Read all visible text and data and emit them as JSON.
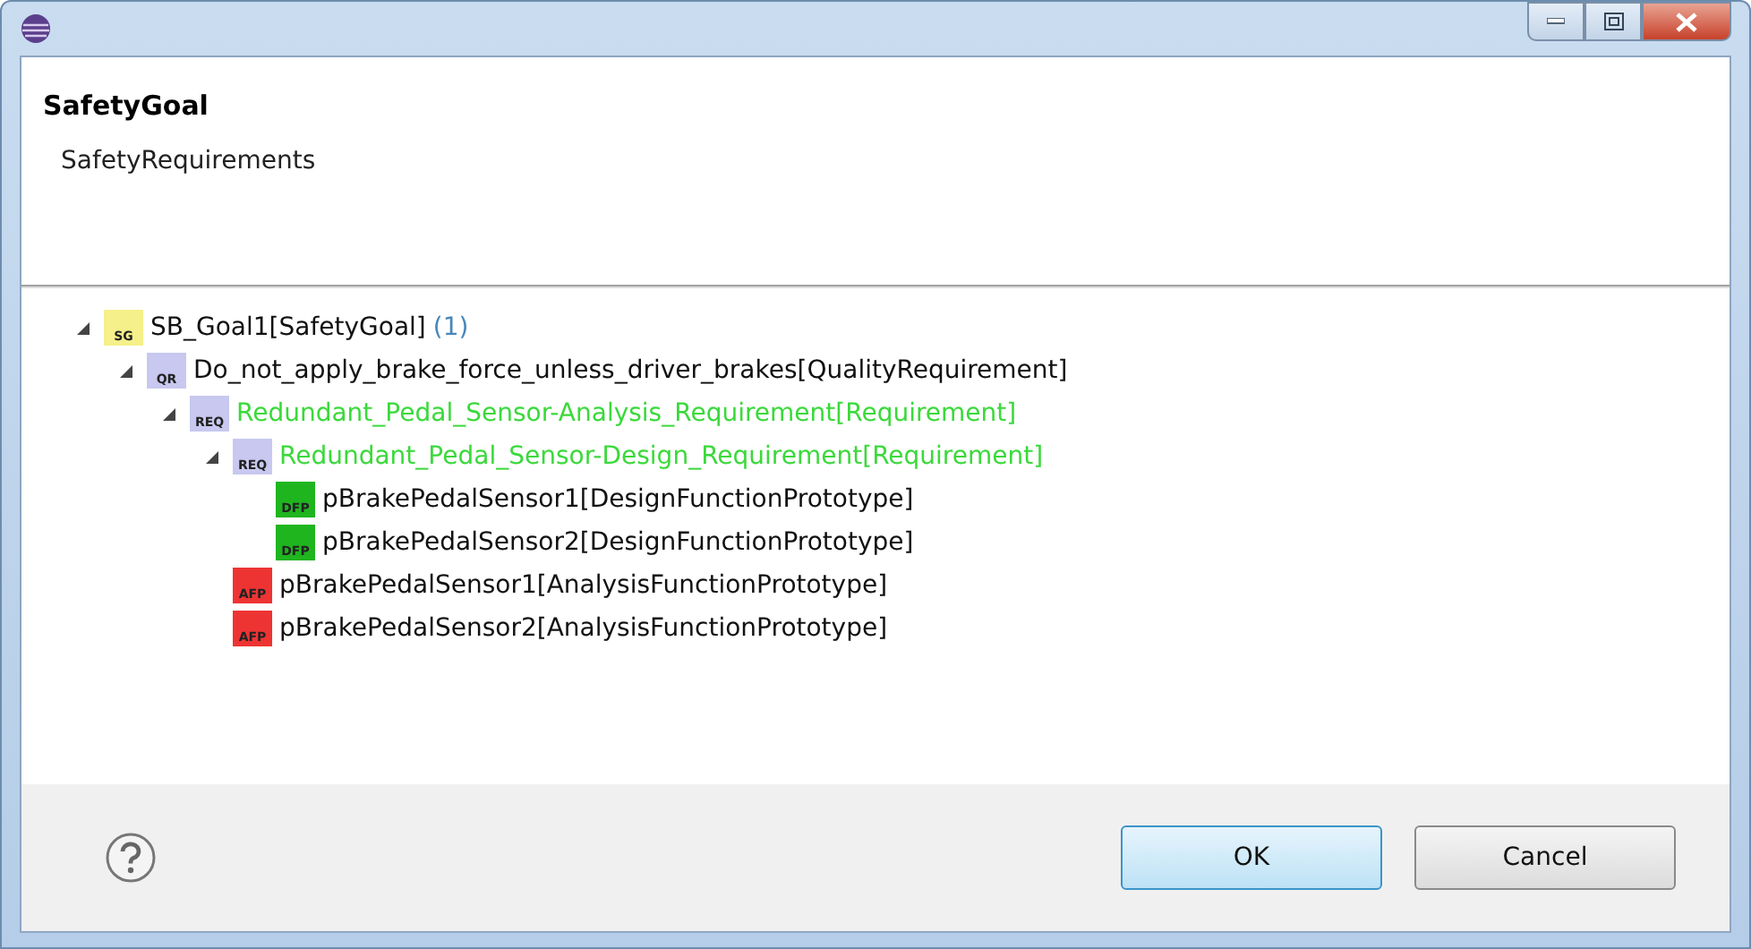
{
  "header": {
    "title": "SafetyGoal",
    "message": "SafetyRequirements"
  },
  "tree": [
    {
      "badge": "SG",
      "color": "#f5f08a",
      "label": "SB_Goal1[SafetyGoal]",
      "count": "(1)",
      "highlighted": false,
      "expanded": true,
      "children": [
        {
          "badge": "QR",
          "color": "#c8c8f0",
          "label": "Do_not_apply_brake_force_unless_driver_brakes[QualityRequirement]",
          "highlighted": false,
          "expanded": true,
          "children": [
            {
              "badge": "REQ",
              "color": "#c8c8f0",
              "label": "Redundant_Pedal_Sensor-Analysis_Requirement[Requirement]",
              "highlighted": true,
              "expanded": true,
              "children": [
                {
                  "badge": "REQ",
                  "color": "#c8c8f0",
                  "label": "Redundant_Pedal_Sensor-Design_Requirement[Requirement]",
                  "highlighted": true,
                  "expanded": true,
                  "children": [
                    {
                      "badge": "DFP",
                      "color": "#1fb51f",
                      "label": "pBrakePedalSensor1[DesignFunctionPrototype]",
                      "highlighted": false
                    },
                    {
                      "badge": "DFP",
                      "color": "#1fb51f",
                      "label": "pBrakePedalSensor2[DesignFunctionPrototype]",
                      "highlighted": false
                    }
                  ]
                },
                {
                  "badge": "AFP",
                  "color": "#ee3333",
                  "label": "pBrakePedalSensor1[AnalysisFunctionPrototype]",
                  "highlighted": false
                },
                {
                  "badge": "AFP",
                  "color": "#ee3333",
                  "label": "pBrakePedalSensor2[AnalysisFunctionPrototype]",
                  "highlighted": false
                }
              ]
            }
          ]
        }
      ]
    }
  ],
  "buttons": [
    {
      "label": "OK",
      "default": true
    },
    {
      "label": "Cancel",
      "default": false
    }
  ]
}
